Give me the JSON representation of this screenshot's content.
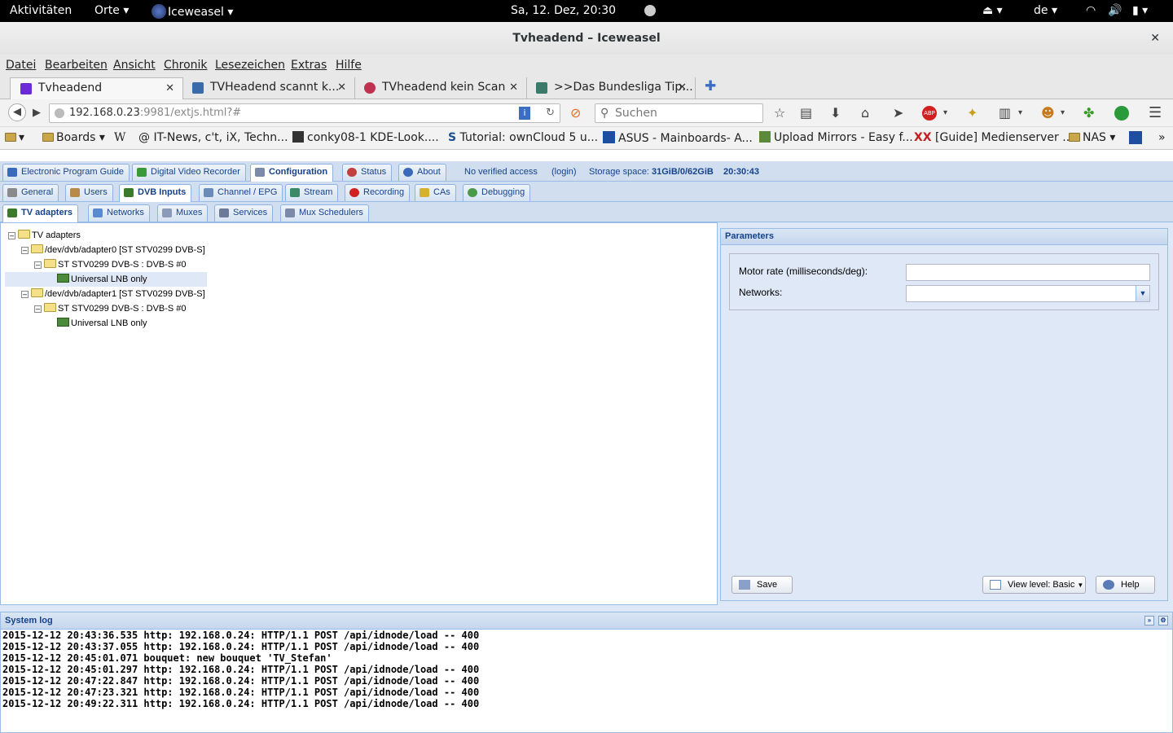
{
  "gnome": {
    "activities": "Aktivitäten",
    "places": "Orte",
    "app": "Iceweasel",
    "clock": "Sa, 12. Dez, 20:30",
    "lang": "de"
  },
  "window": {
    "title": "Tvheadend – Iceweasel"
  },
  "menu": [
    "Datei",
    "Bearbeiten",
    "Ansicht",
    "Chronik",
    "Lesezeichen",
    "Extras",
    "Hilfe"
  ],
  "tabs": [
    {
      "label": "Tvheadend",
      "color": "#6b2bd6"
    },
    {
      "label": "TVHeadend scannt k...",
      "color": "#3a6aa8"
    },
    {
      "label": "TVheadend kein Scan",
      "color": "#c03050"
    },
    {
      "label": ">>Das Bundesliga Tip...",
      "color": "#3a7a6a"
    }
  ],
  "url": {
    "host": "192.168.0.23",
    "rest": ":9981/extjs.html?#"
  },
  "search": {
    "placeholder": "Suchen"
  },
  "bookmarks": [
    "Boards",
    "W",
    "IT-News, c't, iX, Techn...",
    "conky08-1 KDE-Look....",
    "Tutorial: ownCloud 5 u...",
    "ASUS - Mainboards- A...",
    "Upload Mirrors - Easy f...",
    "[Guide] Medienserver ...",
    "NAS"
  ],
  "toptabs": [
    "Electronic Program Guide",
    "Digital Video Recorder",
    "Configuration",
    "Status",
    "About"
  ],
  "status": {
    "access": "No verified access",
    "login": "(login)",
    "storage_label": "Storage space:",
    "storage_value": "31GiB/0/62GiB",
    "time": "20:30:43"
  },
  "conftabs": [
    "General",
    "Users",
    "DVB Inputs",
    "Channel / EPG",
    "Stream",
    "Recording",
    "CAs",
    "Debugging"
  ],
  "dvbtabs": [
    "TV adapters",
    "Networks",
    "Muxes",
    "Services",
    "Mux Schedulers"
  ],
  "tree": [
    {
      "label": "TV adapters"
    },
    {
      "label": "/dev/dvb/adapter0 [ST STV0299 DVB-S]"
    },
    {
      "label": "ST STV0299 DVB-S : DVB-S #0"
    },
    {
      "label": "Universal LNB only"
    },
    {
      "label": "/dev/dvb/adapter1 [ST STV0299 DVB-S]"
    },
    {
      "label": "ST STV0299 DVB-S : DVB-S #0"
    },
    {
      "label": "Universal LNB only"
    }
  ],
  "params": {
    "title": "Parameters",
    "motor_label": "Motor rate (milliseconds/deg):",
    "motor_value": "",
    "networks_label": "Networks:",
    "networks_value": "",
    "save": "Save",
    "viewlevel": "View level: Basic",
    "help": "Help"
  },
  "syslog": {
    "title": "System log",
    "lines": [
      "2015-12-12 20:43:36.535 http: 192.168.0.24: HTTP/1.1 POST /api/idnode/load -- 400",
      "2015-12-12 20:43:37.055 http: 192.168.0.24: HTTP/1.1 POST /api/idnode/load -- 400",
      "2015-12-12 20:45:01.071 bouquet: new bouquet 'TV_Stefan'",
      "2015-12-12 20:45:01.297 http: 192.168.0.24: HTTP/1.1 POST /api/idnode/load -- 400",
      "2015-12-12 20:47:22.847 http: 192.168.0.24: HTTP/1.1 POST /api/idnode/load -- 400",
      "2015-12-12 20:47:23.321 http: 192.168.0.24: HTTP/1.1 POST /api/idnode/load -- 400",
      "2015-12-12 20:49:22.311 http: 192.168.0.24: HTTP/1.1 POST /api/idnode/load -- 400"
    ]
  }
}
